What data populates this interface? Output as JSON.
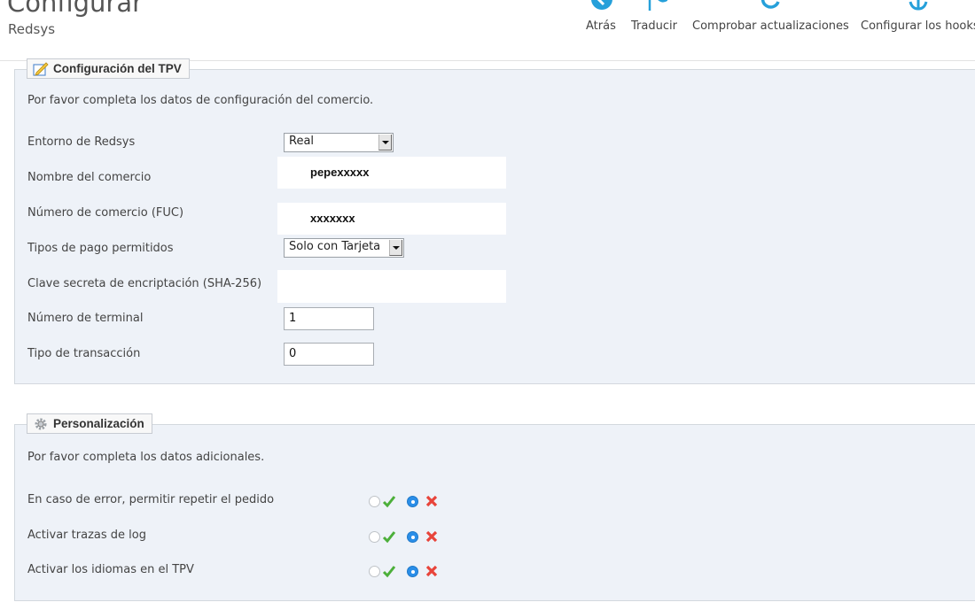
{
  "header": {
    "title": "Configurar",
    "subtitle": "Redsys",
    "toolbar": [
      {
        "label": "Atrás",
        "icon": "back-icon"
      },
      {
        "label": "Traducir",
        "icon": "flag-icon"
      },
      {
        "label": "Comprobar actualizaciones",
        "icon": "refresh-icon"
      },
      {
        "label": "Configurar los hooks",
        "icon": "anchor-icon"
      }
    ]
  },
  "tpv": {
    "legend": "Configuración del TPV",
    "legend_icon": "edit-icon",
    "description": "Por favor completa los datos de configuración del comercio.",
    "fields": [
      {
        "label": "Entorno de Redsys",
        "value": "Real"
      },
      {
        "label": "Nombre del comercio",
        "value": "pepexxxxx"
      },
      {
        "label": "Número de comercio (FUC)",
        "value": "xxxxxxx"
      },
      {
        "label": "Tipos de pago permitidos",
        "value": "Solo con Tarjeta"
      },
      {
        "label": "Clave secreta de encriptación (SHA-256)",
        "value": ""
      },
      {
        "label": "Número de terminal",
        "value": "1"
      },
      {
        "label": "Tipo de transacción",
        "value": "0"
      }
    ]
  },
  "personalizacion": {
    "legend": "Personalización",
    "legend_icon": "gear-icon",
    "description": "Por favor completa los datos adicionales.",
    "options": [
      {
        "label": "En caso de error, permitir repetir el pedido",
        "selected": "no"
      },
      {
        "label": "Activar trazas de log",
        "selected": "no"
      },
      {
        "label": "Activar los idiomas en el TPV",
        "selected": "no"
      }
    ]
  },
  "colors": {
    "accent": "#2a8ee8",
    "yes": "#4caf3a",
    "no": "#e8443a",
    "panel": "#eef2f8"
  }
}
